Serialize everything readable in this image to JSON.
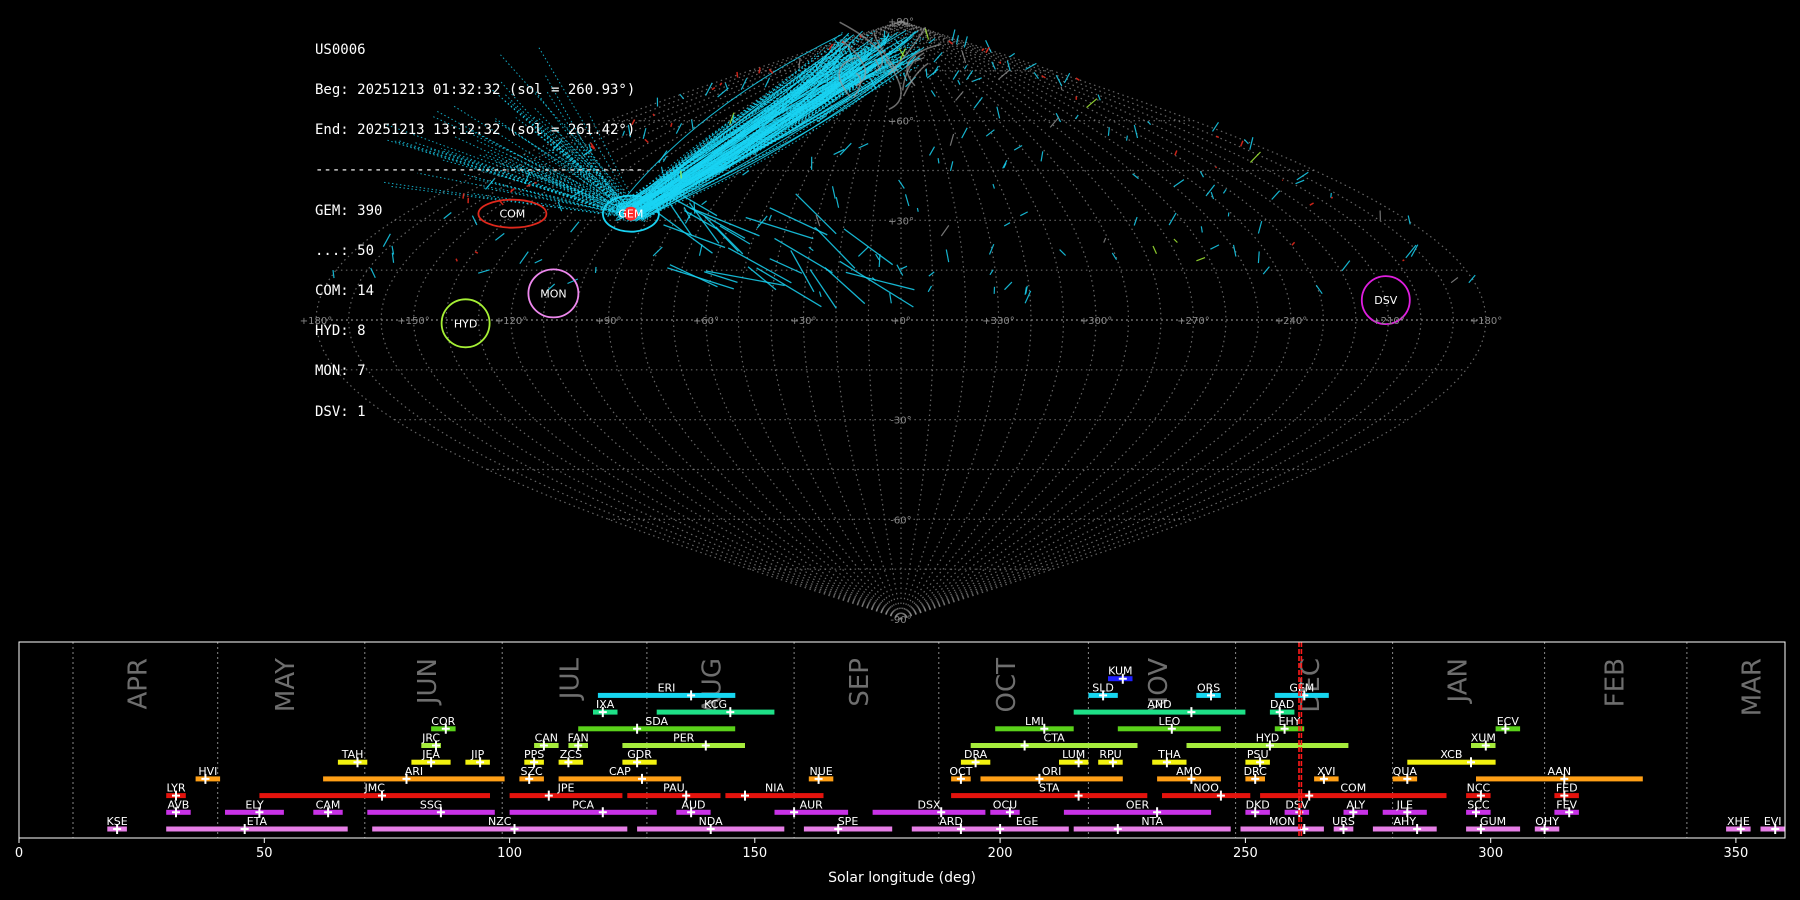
{
  "info": {
    "lines": [
      "US0006",
      "Beg: 20251213 01:32:32 (sol = 260.93°)",
      "End: 20251213 13:12:32 (sol = 261.42°)",
      "---------------------------------------",
      "GEM: 390",
      "...: 50",
      "COM: 14",
      "HYD: 8",
      "MON: 7",
      "DSV: 1"
    ]
  },
  "colors": {
    "grid": "#888888",
    "spor": "#19d3f3",
    "gem": "#ff2a2a",
    "com": "#e0281c",
    "hyd": "#a6f035",
    "mon": "#ee88ee",
    "dsv": "#e01ee0",
    "bar_red": "#e4130d",
    "bar_orange": "#ff9f16",
    "bar_yellow": "#f2f20f",
    "bar_lime": "#a6ec3c",
    "bar_green": "#5ad11a",
    "bar_springgreen": "#1ee087",
    "bar_cyan": "#16d6f0",
    "bar_blue": "#1f1fff",
    "bar_purple": "#c832e6",
    "bar_pink": "#e67ee6"
  },
  "chart_data": [
    {
      "type": "scatter",
      "projection": "sinusoidal",
      "lon_ticks": [
        "+180°",
        "+150°",
        "+120°",
        "+90°",
        "+60°",
        "+30°",
        "+0°",
        "+330°",
        "+300°",
        "+270°",
        "+240°",
        "+210°",
        "+180°"
      ],
      "lat_ticks": [
        "+90°",
        "+60°",
        "+30°",
        "-30°",
        "-60°",
        "-90°"
      ],
      "radiants": [
        {
          "name": "GEM",
          "lon": 98,
          "lat": 32,
          "rx": 28,
          "ry": 18,
          "color": "gem",
          "label_dx": 0,
          "label_dy": 0
        },
        {
          "name": "COM",
          "lon": 141,
          "lat": 32,
          "rx": 34,
          "ry": 14,
          "color": "com",
          "label_dx": 0,
          "label_dy": 0
        },
        {
          "name": "MON",
          "lon": 108,
          "lat": 8,
          "rx": 25,
          "ry": 24,
          "color": "mon",
          "label_dx": 0,
          "label_dy": 0
        },
        {
          "name": "HYD",
          "lon": 134,
          "lat": -1,
          "rx": 24,
          "ry": 24,
          "color": "hyd",
          "label_dx": 0,
          "label_dy": 0
        },
        {
          "name": "DSV",
          "lon": 210,
          "lat": 6,
          "rx": 24,
          "ry": 24,
          "color": "dsv",
          "label_dx": 0,
          "label_dy": 0
        }
      ]
    },
    {
      "type": "bar",
      "orientation": "horizontal-range",
      "xlabel": "Solar longitude (deg)",
      "xlim": [
        0,
        360
      ],
      "xticks": [
        0,
        50,
        100,
        150,
        200,
        250,
        300,
        350
      ],
      "months": [
        {
          "name": "APR",
          "lon": 24,
          "start": 11.0
        },
        {
          "name": "MAY",
          "lon": 54,
          "start": 40.5
        },
        {
          "name": "JUN",
          "lon": 83,
          "start": 70.5
        },
        {
          "name": "JUL",
          "lon": 112,
          "start": 98.5
        },
        {
          "name": "AUG",
          "lon": 141,
          "start": 128.0
        },
        {
          "name": "SEP",
          "lon": 171,
          "start": 158.0
        },
        {
          "name": "OCT",
          "lon": 201,
          "start": 187.5
        },
        {
          "name": "NOV",
          "lon": 232,
          "start": 218.0
        },
        {
          "name": "DEC",
          "lon": 263,
          "start": 248.0
        },
        {
          "name": "JAN",
          "lon": 293,
          "start": 280.0
        },
        {
          "name": "FEB",
          "lon": 325,
          "start": 311.0
        },
        {
          "name": "MAR",
          "lon": 353,
          "start": 340.0
        }
      ],
      "current_sol": [
        260.93,
        261.42
      ],
      "showers": [
        {
          "code": "KUM",
          "start": 222,
          "end": 227,
          "peak": 225,
          "row": 9,
          "color": "bar_blue"
        },
        {
          "code": "ERI",
          "start": 118,
          "end": 146,
          "peak": 137,
          "row": 8,
          "color": "bar_cyan"
        },
        {
          "code": "SLD",
          "start": 218,
          "end": 224,
          "peak": 221,
          "row": 8,
          "color": "bar_cyan"
        },
        {
          "code": "ORS",
          "start": 240,
          "end": 245,
          "peak": 243,
          "row": 8,
          "color": "bar_cyan"
        },
        {
          "code": "GEM",
          "start": 256,
          "end": 267,
          "peak": 262,
          "row": 8,
          "color": "bar_cyan"
        },
        {
          "code": "IXA",
          "start": 117,
          "end": 122,
          "peak": 119,
          "row": 7,
          "color": "bar_springgreen"
        },
        {
          "code": "KCG",
          "start": 130,
          "end": 154,
          "peak": 145,
          "row": 7,
          "color": "bar_springgreen"
        },
        {
          "code": "AND",
          "start": 215,
          "end": 250,
          "peak": 239,
          "row": 7,
          "color": "bar_springgreen"
        },
        {
          "code": "DAD",
          "start": 255,
          "end": 260,
          "peak": 257,
          "row": 7,
          "color": "bar_springgreen"
        },
        {
          "code": "COR",
          "start": 84,
          "end": 89,
          "peak": 87,
          "row": 6,
          "color": "bar_green"
        },
        {
          "code": "SDA",
          "start": 114,
          "end": 146,
          "peak": 126,
          "row": 6,
          "color": "bar_green"
        },
        {
          "code": "LMI",
          "start": 199,
          "end": 215,
          "peak": 209,
          "row": 6,
          "color": "bar_green"
        },
        {
          "code": "LEO",
          "start": 224,
          "end": 245,
          "peak": 235,
          "row": 6,
          "color": "bar_green"
        },
        {
          "code": "EHY",
          "start": 256,
          "end": 262,
          "peak": 258,
          "row": 6,
          "color": "bar_green"
        },
        {
          "code": "ECV",
          "start": 301,
          "end": 306,
          "peak": 303,
          "row": 6,
          "color": "bar_green"
        },
        {
          "code": "JRC",
          "start": 82,
          "end": 86,
          "peak": 85,
          "row": 5,
          "color": "bar_lime"
        },
        {
          "code": "CAN",
          "start": 105,
          "end": 110,
          "peak": 107,
          "row": 5,
          "color": "bar_lime"
        },
        {
          "code": "FAN",
          "start": 112,
          "end": 116,
          "peak": 114,
          "row": 5,
          "color": "bar_lime"
        },
        {
          "code": "PER",
          "start": 123,
          "end": 148,
          "peak": 140,
          "row": 5,
          "color": "bar_lime"
        },
        {
          "code": "CTA",
          "start": 194,
          "end": 228,
          "peak": 205,
          "row": 5,
          "color": "bar_lime"
        },
        {
          "code": "HYD",
          "start": 238,
          "end": 271,
          "peak": 255,
          "row": 5,
          "color": "bar_lime"
        },
        {
          "code": "XUM",
          "start": 296,
          "end": 301,
          "peak": 299,
          "row": 5,
          "color": "bar_lime"
        },
        {
          "code": "TAH",
          "start": 65,
          "end": 71,
          "peak": 69,
          "row": 4,
          "color": "bar_yellow"
        },
        {
          "code": "JEA",
          "start": 80,
          "end": 88,
          "peak": 84,
          "row": 4,
          "color": "bar_yellow"
        },
        {
          "code": "JIP",
          "start": 91,
          "end": 96,
          "peak": 94,
          "row": 4,
          "color": "bar_yellow"
        },
        {
          "code": "PPS",
          "start": 103,
          "end": 107,
          "peak": 105,
          "row": 4,
          "color": "bar_yellow"
        },
        {
          "code": "ZCS",
          "start": 110,
          "end": 115,
          "peak": 112,
          "row": 4,
          "color": "bar_yellow"
        },
        {
          "code": "GDR",
          "start": 123,
          "end": 130,
          "peak": 126,
          "row": 4,
          "color": "bar_yellow"
        },
        {
          "code": "DRA",
          "start": 192,
          "end": 198,
          "peak": 195,
          "row": 4,
          "color": "bar_yellow"
        },
        {
          "code": "LUM",
          "start": 212,
          "end": 218,
          "peak": 216,
          "row": 4,
          "color": "bar_yellow"
        },
        {
          "code": "RPU",
          "start": 220,
          "end": 225,
          "peak": 223,
          "row": 4,
          "color": "bar_yellow"
        },
        {
          "code": "THA",
          "start": 231,
          "end": 238,
          "peak": 234,
          "row": 4,
          "color": "bar_yellow"
        },
        {
          "code": "PSU",
          "start": 250,
          "end": 255,
          "peak": 253,
          "row": 4,
          "color": "bar_yellow"
        },
        {
          "code": "XCB",
          "start": 283,
          "end": 301,
          "peak": 296,
          "row": 4,
          "color": "bar_yellow"
        },
        {
          "code": "HVI",
          "start": 36,
          "end": 41,
          "peak": 38,
          "row": 3,
          "color": "bar_orange"
        },
        {
          "code": "ARI",
          "start": 62,
          "end": 99,
          "peak": 79,
          "row": 3,
          "color": "bar_orange"
        },
        {
          "code": "SZC",
          "start": 102,
          "end": 107,
          "peak": 104,
          "row": 3,
          "color": "bar_orange"
        },
        {
          "code": "CAP",
          "start": 110,
          "end": 135,
          "peak": 127,
          "row": 3,
          "color": "bar_orange"
        },
        {
          "code": "NUE",
          "start": 161,
          "end": 166,
          "peak": 163,
          "row": 3,
          "color": "bar_orange"
        },
        {
          "code": "OCT",
          "start": 190,
          "end": 194,
          "peak": 192,
          "row": 3,
          "color": "bar_orange"
        },
        {
          "code": "ORI",
          "start": 196,
          "end": 225,
          "peak": 208,
          "row": 3,
          "color": "bar_orange"
        },
        {
          "code": "AMO",
          "start": 232,
          "end": 245,
          "peak": 239,
          "row": 3,
          "color": "bar_orange"
        },
        {
          "code": "DRC",
          "start": 250,
          "end": 254,
          "peak": 252,
          "row": 3,
          "color": "bar_orange"
        },
        {
          "code": "XVI",
          "start": 264,
          "end": 269,
          "peak": 266,
          "row": 3,
          "color": "bar_orange"
        },
        {
          "code": "QUA",
          "start": 280,
          "end": 285,
          "peak": 283,
          "row": 3,
          "color": "bar_orange"
        },
        {
          "code": "AAN",
          "start": 297,
          "end": 331,
          "peak": 315,
          "row": 3,
          "color": "bar_orange"
        },
        {
          "code": "LYR",
          "start": 30,
          "end": 34,
          "peak": 32,
          "row": 2,
          "color": "bar_red"
        },
        {
          "code": "JMC",
          "start": 49,
          "end": 96,
          "peak": 74,
          "row": 2,
          "color": "bar_red"
        },
        {
          "code": "JPE",
          "start": 100,
          "end": 123,
          "peak": 108,
          "row": 2,
          "color": "bar_red"
        },
        {
          "code": "PAU",
          "start": 124,
          "end": 143,
          "peak": 136,
          "row": 2,
          "color": "bar_red"
        },
        {
          "code": "NIA",
          "start": 144,
          "end": 164,
          "peak": 148,
          "row": 2,
          "color": "bar_red"
        },
        {
          "code": "STA",
          "start": 190,
          "end": 230,
          "peak": 216,
          "row": 2,
          "color": "bar_red"
        },
        {
          "code": "NOO",
          "start": 233,
          "end": 251,
          "peak": 245,
          "row": 2,
          "color": "bar_red"
        },
        {
          "code": "COM",
          "start": 253,
          "end": 291,
          "peak": 263,
          "row": 2,
          "color": "bar_red"
        },
        {
          "code": "NCC",
          "start": 295,
          "end": 300,
          "peak": 298,
          "row": 2,
          "color": "bar_red"
        },
        {
          "code": "FED",
          "start": 313,
          "end": 318,
          "peak": 315,
          "row": 2,
          "color": "bar_red"
        },
        {
          "code": "AVB",
          "start": 30,
          "end": 35,
          "peak": 32,
          "row": 1,
          "color": "bar_purple"
        },
        {
          "code": "ELY",
          "start": 42,
          "end": 54,
          "peak": 49,
          "row": 1,
          "color": "bar_purple"
        },
        {
          "code": "CAM",
          "start": 60,
          "end": 66,
          "peak": 63,
          "row": 1,
          "color": "bar_purple"
        },
        {
          "code": "SSG",
          "start": 71,
          "end": 97,
          "peak": 86,
          "row": 1,
          "color": "bar_purple"
        },
        {
          "code": "PCA",
          "start": 100,
          "end": 130,
          "peak": 119,
          "row": 1,
          "color": "bar_purple"
        },
        {
          "code": "AUD",
          "start": 134,
          "end": 141,
          "peak": 137,
          "row": 1,
          "color": "bar_purple"
        },
        {
          "code": "AUR",
          "start": 154,
          "end": 169,
          "peak": 158,
          "row": 1,
          "color": "bar_purple"
        },
        {
          "code": "DSX",
          "start": 174,
          "end": 197,
          "peak": 188,
          "row": 1,
          "color": "bar_purple"
        },
        {
          "code": "OCU",
          "start": 198,
          "end": 204,
          "peak": 202,
          "row": 1,
          "color": "bar_purple"
        },
        {
          "code": "OER",
          "start": 213,
          "end": 243,
          "peak": 232,
          "row": 1,
          "color": "bar_purple"
        },
        {
          "code": "DKD",
          "start": 250,
          "end": 255,
          "peak": 252,
          "row": 1,
          "color": "bar_purple"
        },
        {
          "code": "DSV",
          "start": 258,
          "end": 263,
          "peak": 261,
          "row": 1,
          "color": "bar_purple"
        },
        {
          "code": "ALY",
          "start": 270,
          "end": 275,
          "peak": 272,
          "row": 1,
          "color": "bar_purple"
        },
        {
          "code": "JLE",
          "start": 278,
          "end": 287,
          "peak": 283,
          "row": 1,
          "color": "bar_purple"
        },
        {
          "code": "SCC",
          "start": 295,
          "end": 300,
          "peak": 297,
          "row": 1,
          "color": "bar_purple"
        },
        {
          "code": "FEV",
          "start": 313,
          "end": 318,
          "peak": 316,
          "row": 1,
          "color": "bar_purple"
        },
        {
          "code": "KSE",
          "start": 18,
          "end": 22,
          "peak": 20,
          "row": 0,
          "color": "bar_pink"
        },
        {
          "code": "ETA",
          "start": 30,
          "end": 67,
          "peak": 46,
          "row": 0,
          "color": "bar_pink"
        },
        {
          "code": "NZC",
          "start": 72,
          "end": 124,
          "peak": 101,
          "row": 0,
          "color": "bar_pink"
        },
        {
          "code": "NDA",
          "start": 126,
          "end": 156,
          "peak": 141,
          "row": 0,
          "color": "bar_pink"
        },
        {
          "code": "SPE",
          "start": 160,
          "end": 178,
          "peak": 167,
          "row": 0,
          "color": "bar_pink"
        },
        {
          "code": "ARD",
          "start": 182,
          "end": 198,
          "peak": 192,
          "row": 0,
          "color": "bar_pink"
        },
        {
          "code": "EGE",
          "start": 197,
          "end": 214,
          "peak": 200,
          "row": 0,
          "color": "bar_pink"
        },
        {
          "code": "NTA",
          "start": 215,
          "end": 247,
          "peak": 224,
          "row": 0,
          "color": "bar_pink"
        },
        {
          "code": "MON",
          "start": 249,
          "end": 266,
          "peak": 262,
          "row": 0,
          "color": "bar_pink"
        },
        {
          "code": "URS",
          "start": 268,
          "end": 272,
          "peak": 270,
          "row": 0,
          "color": "bar_pink"
        },
        {
          "code": "AHY",
          "start": 276,
          "end": 289,
          "peak": 285,
          "row": 0,
          "color": "bar_pink"
        },
        {
          "code": "GUM",
          "start": 295,
          "end": 306,
          "peak": 298,
          "row": 0,
          "color": "bar_pink"
        },
        {
          "code": "OHY",
          "start": 309,
          "end": 314,
          "peak": 311,
          "row": 0,
          "color": "bar_pink"
        },
        {
          "code": "XHE",
          "start": 348,
          "end": 353,
          "peak": 351,
          "row": 0,
          "color": "bar_pink"
        },
        {
          "code": "EVI",
          "start": 355,
          "end": 360,
          "peak": 358,
          "row": 0,
          "color": "bar_pink"
        }
      ]
    }
  ]
}
